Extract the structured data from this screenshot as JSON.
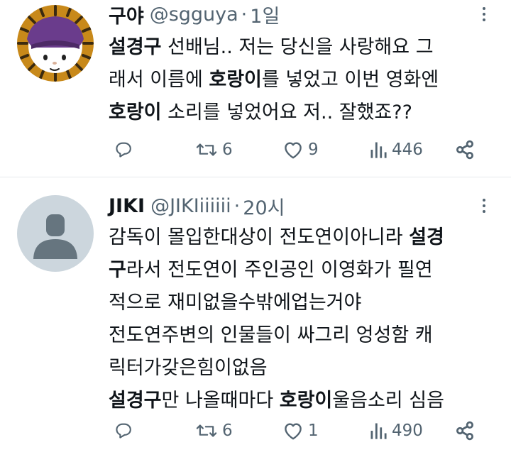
{
  "tweets": [
    {
      "name": "구야",
      "handle": "@sgguya",
      "separator": "·",
      "time": "1일",
      "lines": [
        [
          {
            "t": "설경구",
            "b": true
          },
          {
            "t": " 선배님.. 저는 당신을 사랑해요 그"
          }
        ],
        [
          {
            "t": "래서 이름에 "
          },
          {
            "t": "호랑이",
            "b": true
          },
          {
            "t": "를 넣었고 이번 영화엔"
          }
        ],
        [
          {
            "t": "호랑이",
            "b": true
          },
          {
            "t": " 소리를 넣었어요 저.. 잘했죠??"
          }
        ]
      ],
      "reply_count": "",
      "retweet_count": "6",
      "like_count": "9",
      "view_count": "446"
    },
    {
      "name": "JIKI",
      "handle": "@JIKIiiiiii",
      "separator": "·",
      "time": "20시",
      "lines": [
        [
          {
            "t": "감독이 몰입한대상이 전도연이아니라 "
          },
          {
            "t": "설경",
            "b": true
          }
        ],
        [
          {
            "t": "구",
            "b": true
          },
          {
            "t": "라서 전도연이 주인공인 이영화가 필연"
          }
        ],
        [
          {
            "t": "적으로 재미없을수밖에업는거야"
          }
        ],
        [
          {
            "t": "전도연주변의 인물들이 싸그리 엉성함 캐"
          }
        ],
        [
          {
            "t": "릭터가갖은힘이없음"
          }
        ],
        [
          {
            "t": "설경구",
            "b": true
          },
          {
            "t": "만 나올때마다 "
          },
          {
            "t": "호랑이",
            "b": true
          },
          {
            "t": "울음소리 심음"
          }
        ]
      ],
      "reply_count": "",
      "retweet_count": "6",
      "like_count": "1",
      "view_count": "490"
    }
  ],
  "icons": {
    "reply": "reply-icon",
    "retweet": "retweet-icon",
    "like": "heart-icon",
    "views": "views-icon",
    "share": "share-icon",
    "more": "more-icon"
  },
  "colors": {
    "text": "#0f1419",
    "secondary": "#536471",
    "divider": "#e6e9ec",
    "avatar_placeholder": "#ccd6dd",
    "avatar_silhouette": "#66757f"
  }
}
